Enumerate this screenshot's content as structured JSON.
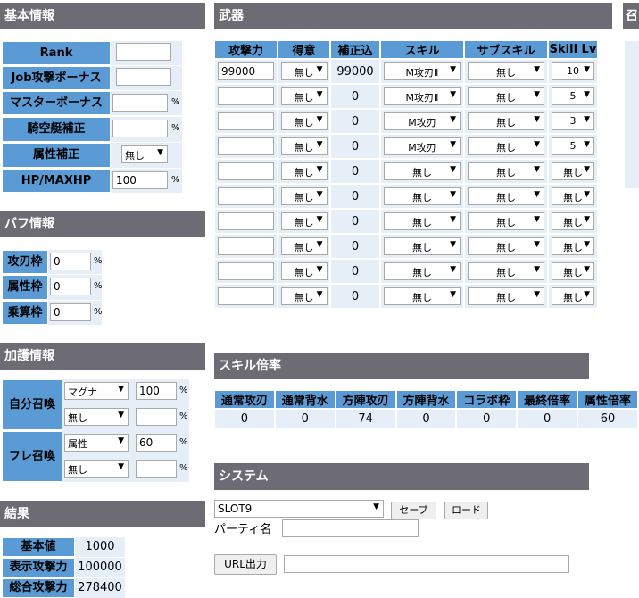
{
  "basic": {
    "title": "基本情報",
    "rank_label": "Rank",
    "job_label": "Job攻撃ボーナス",
    "master_label": "マスターボーナス",
    "airship_label": "騎空艇補正",
    "element_label": "属性補正",
    "element_value": "無し",
    "hp_label": "HP/MAXHP",
    "hp_value": "100",
    "pct": "%"
  },
  "buff": {
    "title": "バフ情報",
    "rows": [
      {
        "label": "攻刃枠",
        "value": "0"
      },
      {
        "label": "属性枠",
        "value": "0"
      },
      {
        "label": "乗算枠",
        "value": "0"
      }
    ]
  },
  "summon": {
    "title": "加護情報",
    "self_label": "自分召喚",
    "friend_label": "フレ召喚",
    "rows": [
      {
        "type": "マグナ",
        "value": "100"
      },
      {
        "type": "無し",
        "value": ""
      },
      {
        "type": "属性",
        "value": "60"
      },
      {
        "type": "無し",
        "value": ""
      }
    ]
  },
  "result": {
    "title": "結果",
    "rows": [
      {
        "label": "基本値",
        "value": "1000"
      },
      {
        "label": "表示攻撃力",
        "value": "100000"
      },
      {
        "label": "総合攻撃力",
        "value": "278400"
      }
    ]
  },
  "weapons": {
    "title": "武器",
    "headers": [
      "攻撃力",
      "得意",
      "補正込",
      "スキル",
      "サブスキル",
      "Skill Lv"
    ],
    "rows": [
      {
        "atk": "99000",
        "fav": "無し",
        "corr": "99000",
        "skill": "M攻刃Ⅱ",
        "sub": "無し",
        "lv": "10"
      },
      {
        "atk": "",
        "fav": "無し",
        "corr": "0",
        "skill": "M攻刃Ⅱ",
        "sub": "無し",
        "lv": "5"
      },
      {
        "atk": "",
        "fav": "無し",
        "corr": "0",
        "skill": "M攻刃",
        "sub": "無し",
        "lv": "3"
      },
      {
        "atk": "",
        "fav": "無し",
        "corr": "0",
        "skill": "M攻刃",
        "sub": "無し",
        "lv": "5"
      },
      {
        "atk": "",
        "fav": "無し",
        "corr": "0",
        "skill": "無し",
        "sub": "無し",
        "lv": "無し"
      },
      {
        "atk": "",
        "fav": "無し",
        "corr": "0",
        "skill": "無し",
        "sub": "無し",
        "lv": "無し"
      },
      {
        "atk": "",
        "fav": "無し",
        "corr": "0",
        "skill": "無し",
        "sub": "無し",
        "lv": "無し"
      },
      {
        "atk": "",
        "fav": "無し",
        "corr": "0",
        "skill": "無し",
        "sub": "無し",
        "lv": "無し"
      },
      {
        "atk": "",
        "fav": "無し",
        "corr": "0",
        "skill": "無し",
        "sub": "無し",
        "lv": "無し"
      },
      {
        "atk": "",
        "fav": "無し",
        "corr": "0",
        "skill": "無し",
        "sub": "無し",
        "lv": "無し"
      }
    ]
  },
  "skill_rate": {
    "title": "スキル倍率",
    "headers": [
      "通常攻刃",
      "通常背水",
      "方陣攻刃",
      "方陣背水",
      "コラボ枠",
      "最終倍率",
      "属性倍率"
    ],
    "values": [
      "0",
      "0",
      "74",
      "0",
      "0",
      "0",
      "60"
    ]
  },
  "system": {
    "title": "システム",
    "slot": "SLOT9",
    "save": "セーブ",
    "load": "ロード",
    "party_label": "パーティ名",
    "url_button": "URL出力"
  },
  "cutoff_header": "召"
}
